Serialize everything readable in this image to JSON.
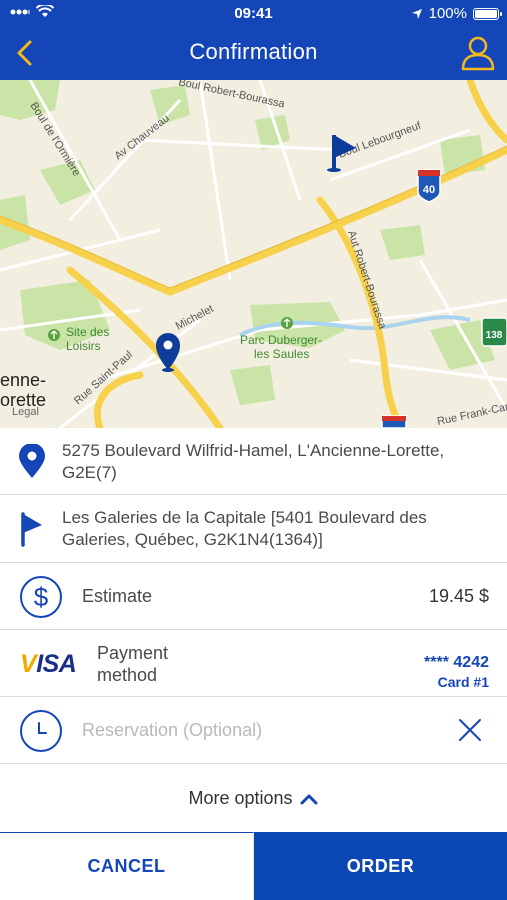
{
  "status_bar": {
    "time": "09:41",
    "battery": "100%"
  },
  "nav": {
    "title": "Confirmation",
    "back_icon": "chevron-left-icon",
    "profile_icon": "user-icon"
  },
  "map": {
    "labels": {
      "boul_ormiere": "Boul de l'Ormière",
      "av_chauveau": "Av Chauveau",
      "boul_robert_top": "Boul Robert-Bourassa",
      "boul_lebourgneuf": "Boul Lebourgneuf",
      "aut_robert": "Aut Robert-Bourassa",
      "site_loisirs_1": "Site des",
      "site_loisirs_2": "Loisirs",
      "parc_1": "Parc Duberger-",
      "parc_2": "les Saules",
      "michelet": "Michelet",
      "saint_paul": "Rue Saint-Paul",
      "ancienne_1": "enne-",
      "ancienne_2": "orette",
      "frank": "Rue Frank-Carrel",
      "legal": "Legal",
      "shield_40": "40",
      "shield_138": "138"
    }
  },
  "trip": {
    "from_icon": "location-pin-icon",
    "from": "5275 Boulevard Wilfrid-Hamel, L'Ancienne-Lorette, G2E(7)",
    "to_icon": "flag-icon",
    "to": "Les Galeries de la Capitale [5401 Boulevard des Galeries, Québec, G2K1N4(1364)]"
  },
  "estimate": {
    "icon": "dollar-icon",
    "label": "Estimate",
    "value": "19.45 $"
  },
  "payment": {
    "brand": "VISA",
    "label": "Payment method",
    "card_number": "**** 4242",
    "card_name": "Card #1"
  },
  "reservation": {
    "icon": "clock-icon",
    "placeholder": "Reservation (Optional)",
    "clear_icon": "close-icon"
  },
  "more_options": {
    "label": "More options",
    "icon": "chevron-up-icon"
  },
  "actions": {
    "cancel": "CANCEL",
    "order": "ORDER"
  },
  "colors": {
    "primary": "#1546b8",
    "order_button": "#0b47b5",
    "visa_gold": "#f2a900"
  }
}
